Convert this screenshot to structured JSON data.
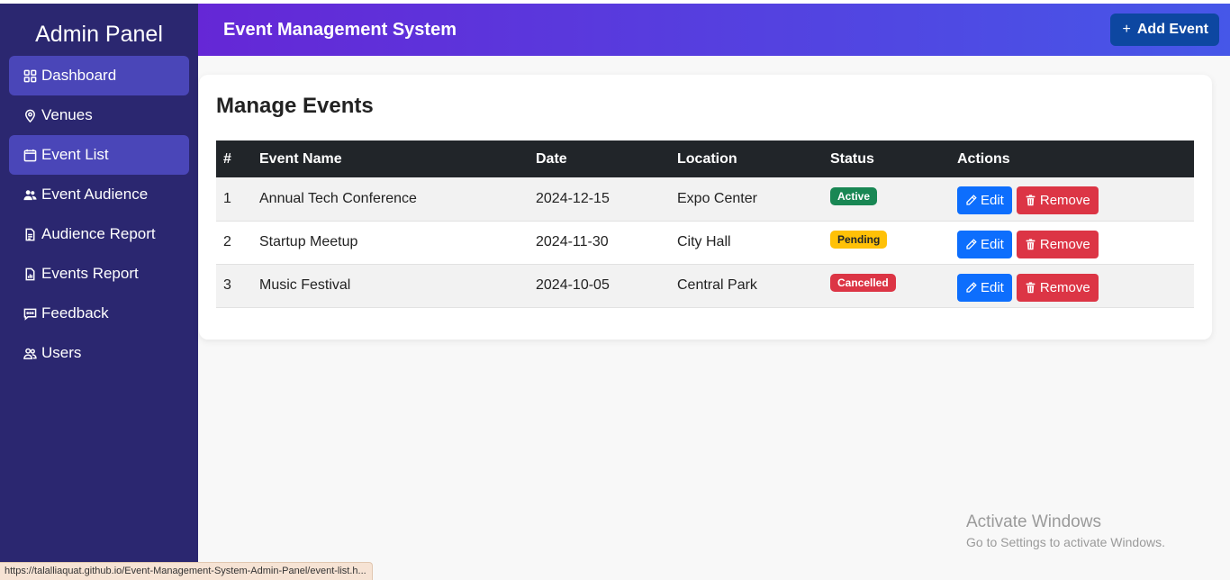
{
  "sidebar": {
    "brand": "Admin Panel",
    "items": [
      {
        "label": "Dashboard",
        "icon": "grid-icon",
        "active": true
      },
      {
        "label": "Venues",
        "icon": "location-pin-icon",
        "active": false
      },
      {
        "label": "Event List",
        "icon": "calendar-icon",
        "active": true
      },
      {
        "label": "Event Audience",
        "icon": "people-icon",
        "active": false
      },
      {
        "label": "Audience Report",
        "icon": "document-icon",
        "active": false
      },
      {
        "label": "Events Report",
        "icon": "bar-chart-document-icon",
        "active": false
      },
      {
        "label": "Feedback",
        "icon": "chat-dots-icon",
        "active": false
      },
      {
        "label": "Users",
        "icon": "users-icon",
        "active": false
      }
    ]
  },
  "header": {
    "title": "Event Management System",
    "add_button": {
      "icon": "plus-icon",
      "label": "Add Event"
    }
  },
  "main": {
    "title": "Manage Events",
    "table": {
      "columns": [
        "#",
        "Event Name",
        "Date",
        "Location",
        "Status",
        "Actions"
      ],
      "rows": [
        {
          "num": "1",
          "name": "Annual Tech Conference",
          "date": "2024-12-15",
          "location": "Expo Center",
          "status": "Active",
          "status_color": "#198754"
        },
        {
          "num": "2",
          "name": "Startup Meetup",
          "date": "2024-11-30",
          "location": "City Hall",
          "status": "Pending",
          "status_color": "#ffc107"
        },
        {
          "num": "3",
          "name": "Music Festival",
          "date": "2024-10-05",
          "location": "Central Park",
          "status": "Cancelled",
          "status_color": "#dc3545"
        }
      ],
      "edit_label": "Edit",
      "remove_label": "Remove"
    }
  },
  "overlay": {
    "watermark_line1": "Activate Windows",
    "watermark_line2": "Go to Settings to activate Windows.",
    "status_url": "https://talalliaquat.github.io/Event-Management-System-Admin-Panel/event-list.h..."
  },
  "colors": {
    "sidebar_bg": "#2b2770",
    "active_item_bg": "#4a46b8",
    "header_gradient_start": "#6527d6",
    "header_gradient_end": "#4657e8",
    "add_button_bg": "#0d47a1",
    "edit_button_bg": "#0d6efd",
    "remove_button_bg": "#dc3545"
  }
}
